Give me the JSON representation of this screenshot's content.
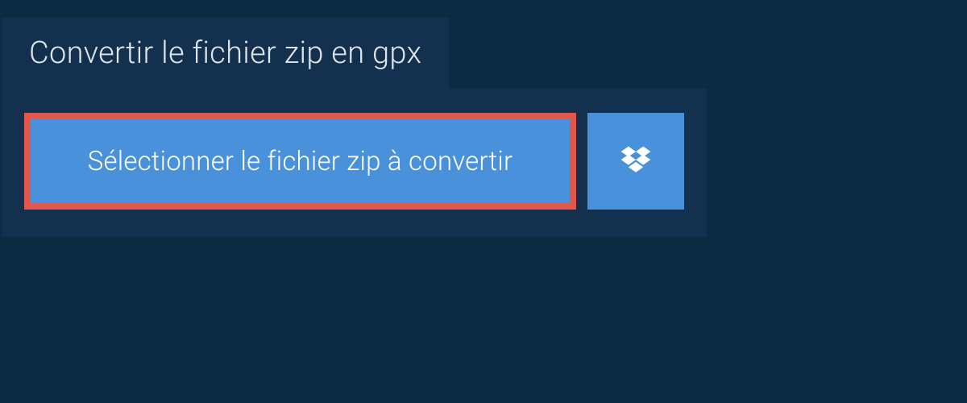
{
  "title": "Convertir le fichier zip en gpx",
  "buttons": {
    "select_label": "Sélectionner le fichier zip à convertir"
  },
  "colors": {
    "background": "#0d2a43",
    "panel": "#13314e",
    "button": "#4991db",
    "highlight_border": "#e2574c",
    "text_light": "#dfe5ea",
    "text_white": "#ffffff"
  }
}
